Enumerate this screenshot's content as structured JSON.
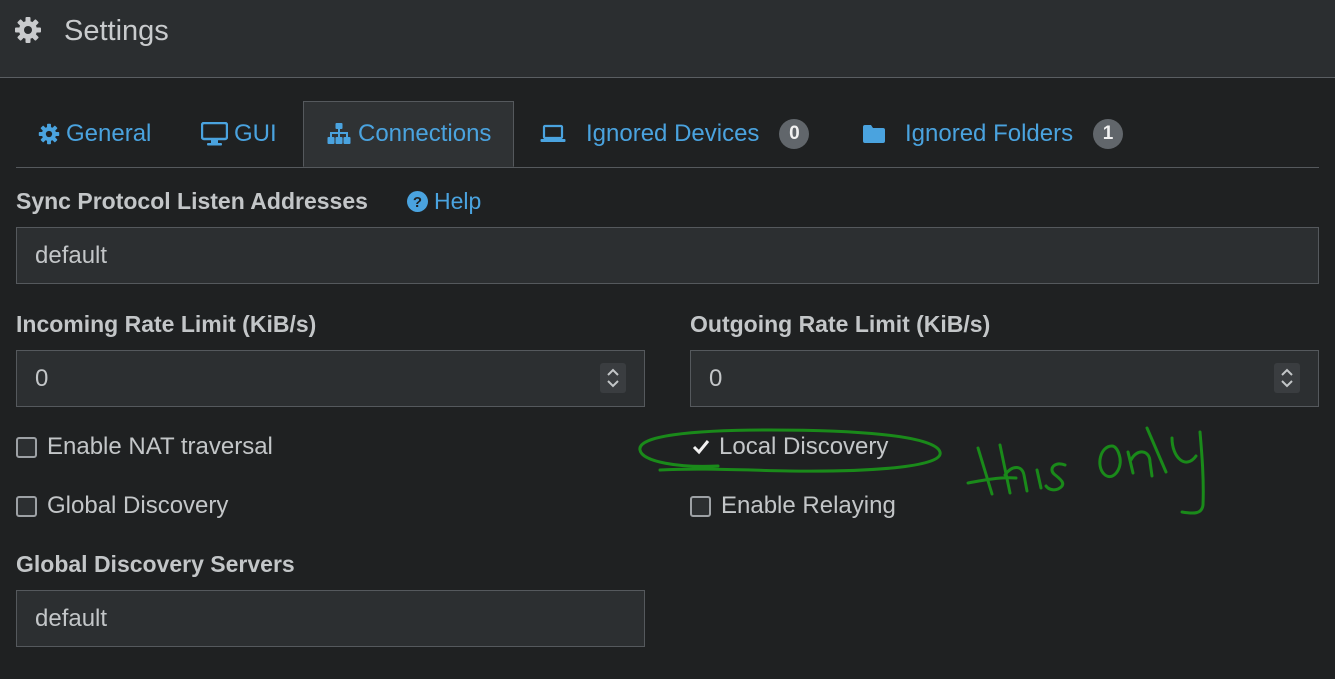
{
  "header": {
    "title": "Settings",
    "icon": "gear-icon"
  },
  "tabs": [
    {
      "label": "General",
      "icon": "gear-icon"
    },
    {
      "label": "GUI",
      "icon": "monitor-icon"
    },
    {
      "label": "Connections",
      "icon": "sitemap-icon",
      "active": true
    },
    {
      "label": "Ignored Devices",
      "icon": "laptop-icon",
      "badge": "0"
    },
    {
      "label": "Ignored Folders",
      "icon": "folder-icon",
      "badge": "1"
    }
  ],
  "listen": {
    "label": "Sync Protocol Listen Addresses",
    "help": "Help",
    "value": "default"
  },
  "incoming": {
    "label": "Incoming Rate Limit (KiB/s)",
    "value": "0"
  },
  "outgoing": {
    "label": "Outgoing Rate Limit (KiB/s)",
    "value": "0"
  },
  "checks": {
    "nat": {
      "label": "Enable NAT traversal",
      "checked": false
    },
    "local": {
      "label": "Local Discovery",
      "checked": true
    },
    "global": {
      "label": "Global Discovery",
      "checked": false
    },
    "relay": {
      "label": "Enable Relaying",
      "checked": false
    }
  },
  "servers": {
    "label": "Global Discovery Servers",
    "value": "default"
  },
  "annotation": {
    "text": "this only",
    "color": "#1a8a1a"
  },
  "colors": {
    "accent": "#4aa3df",
    "background": "#1f2122",
    "header": "#2b2e30"
  }
}
